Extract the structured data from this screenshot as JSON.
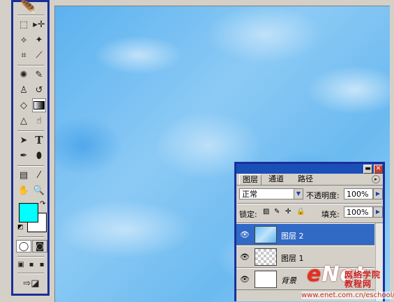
{
  "toolbox": {
    "tools": [
      "rect-marquee-icon",
      "move-icon",
      "polygon-lasso-icon",
      "magic-wand-icon",
      "crop-icon",
      "slice-icon",
      "healing-brush-icon",
      "brush-icon",
      "clone-stamp-icon",
      "history-brush-icon",
      "eraser-icon",
      "gradient-icon",
      "blur-icon",
      "dodge-icon",
      "path-select-icon",
      "type-icon",
      "pen-icon",
      "ellipse-shape-icon",
      "notes-icon",
      "eyedropper-icon",
      "hand-icon",
      "zoom-icon"
    ],
    "type_tool_label": "T",
    "foreground_color": "#00ffff",
    "background_color": "#ffffff"
  },
  "layers_panel": {
    "tabs": [
      "图层",
      "通道",
      "路径"
    ],
    "blend_mode": "正常",
    "opacity_label": "不透明度:",
    "opacity_value": "100%",
    "lock_label": "锁定:",
    "fill_label": "填充:",
    "fill_value": "100%",
    "layers": [
      {
        "name": "图层 2",
        "selected": true
      },
      {
        "name": "图层 1",
        "selected": false
      },
      {
        "name": "背景",
        "selected": false
      }
    ]
  },
  "watermark": {
    "logo_prefix": "e",
    "logo_main": "Net",
    "chinese": "网络学院",
    "chinese2": "教程网",
    "url": "www.enet.com.cn/eschool/"
  }
}
